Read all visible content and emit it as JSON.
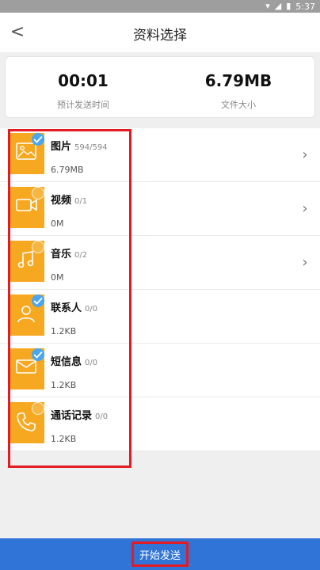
{
  "status_bar": {
    "time": "5:37"
  },
  "header": {
    "title": "资料选择",
    "back_glyph": "<"
  },
  "summary": {
    "time_value": "00:01",
    "time_label": "预计发送时间",
    "size_value": "6.79MB",
    "size_label": "文件大小"
  },
  "items": [
    {
      "name": "图片",
      "count": "594/594",
      "size": "6.79MB",
      "selected": true,
      "has_chevron": true,
      "icon": "image-icon"
    },
    {
      "name": "视频",
      "count": "0/1",
      "size": "0M",
      "selected": false,
      "has_chevron": true,
      "icon": "video-icon"
    },
    {
      "name": "音乐",
      "count": "0/2",
      "size": "0M",
      "selected": false,
      "has_chevron": true,
      "icon": "music-icon"
    },
    {
      "name": "联系人",
      "count": "0/0",
      "size": "1.2KB",
      "selected": true,
      "has_chevron": false,
      "icon": "contact-icon"
    },
    {
      "name": "短信息",
      "count": "0/0",
      "size": "1.2KB",
      "selected": true,
      "has_chevron": false,
      "icon": "message-icon"
    },
    {
      "name": "通话记录",
      "count": "0/0",
      "size": "1.2KB",
      "selected": false,
      "has_chevron": false,
      "icon": "phone-icon"
    }
  ],
  "bottom": {
    "button_label": "开始发送"
  },
  "colors": {
    "accent": "#f6a821",
    "check": "#4aa6ee",
    "primary": "#2f74d6",
    "highlight": "#e31b23"
  }
}
